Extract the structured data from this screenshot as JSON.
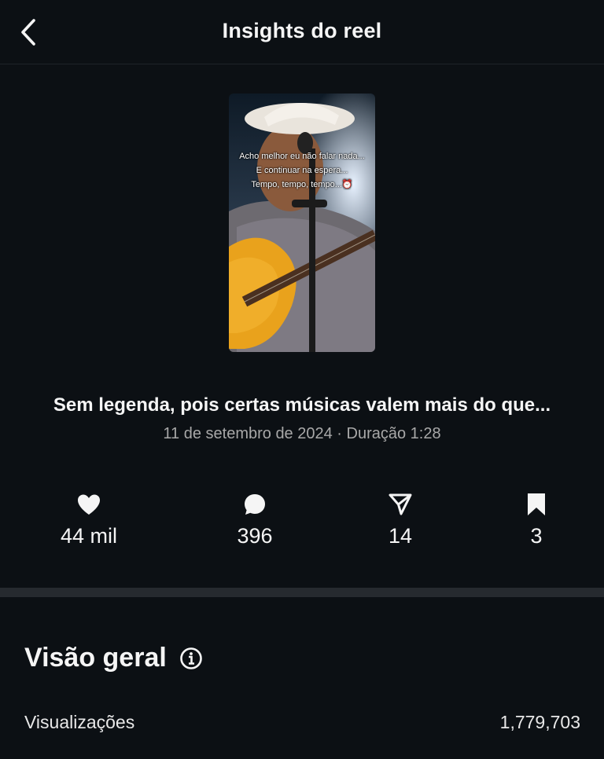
{
  "header": {
    "title": "Insights do reel"
  },
  "reel": {
    "overlay_lines": [
      "Acho melhor eu não falar nada...",
      "E continuar na espera...",
      "Tempo, tempo, tempo...⏰"
    ],
    "caption": "Sem legenda, pois certas músicas valem mais do que...",
    "meta": "11 de setembro de 2024 · Duração 1:28"
  },
  "stats": {
    "likes": "44 mil",
    "comments": "396",
    "shares": "14",
    "saves": "3"
  },
  "overview": {
    "title": "Visão geral",
    "rows": [
      {
        "label": "Visualizações",
        "value": "1,779,703"
      }
    ]
  }
}
